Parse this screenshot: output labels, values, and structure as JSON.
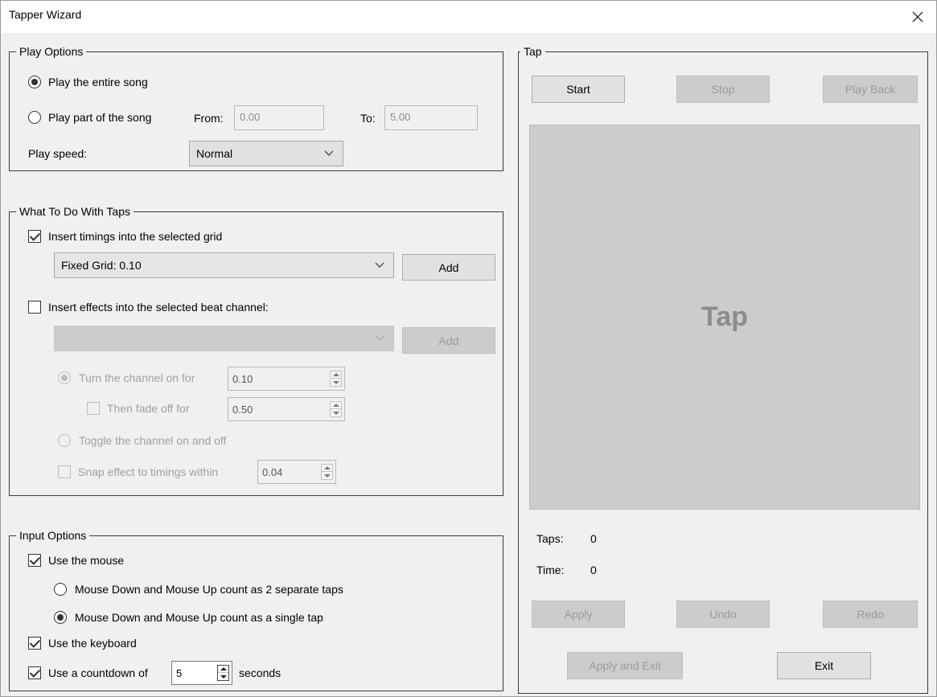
{
  "window": {
    "title": "Tapper Wizard"
  },
  "play_options": {
    "legend": "Play Options",
    "entire_song_label": "Play the entire song",
    "part_song_label": "Play part of the song",
    "from_label": "From:",
    "from_value": "0.00",
    "to_label": "To:",
    "to_value": "5.00",
    "speed_label": "Play speed:",
    "speed_value": "Normal"
  },
  "taps": {
    "legend": "What To Do With Taps",
    "insert_timings_label": "Insert timings into the selected grid",
    "grid_value": "Fixed Grid: 0.10",
    "add_label": "Add",
    "insert_effects_label": "Insert effects into the selected beat channel:",
    "effects_value": "",
    "add2_label": "Add",
    "turn_on_label": "Turn the channel on for",
    "turn_on_value": "0.10",
    "fade_label": "Then fade off for",
    "fade_value": "0.50",
    "toggle_label": "Toggle the channel on and off",
    "snap_label": "Snap effect to timings within",
    "snap_value": "0.04"
  },
  "input_options": {
    "legend": "Input Options",
    "use_mouse_label": "Use the mouse",
    "mouse_separate_label": "Mouse Down and Mouse Up count as 2 separate taps",
    "mouse_single_label": "Mouse Down and Mouse Up count as a single tap",
    "use_keyboard_label": "Use the keyboard",
    "countdown_label": "Use a countdown of",
    "countdown_value": "5",
    "seconds_label": "seconds"
  },
  "tap_panel": {
    "legend": "Tap",
    "start_label": "Start",
    "stop_label": "Stop",
    "playback_label": "Play Back",
    "tap_area_label": "Tap",
    "taps_label": "Taps:",
    "taps_value": "0",
    "time_label": "Time:",
    "time_value": "0",
    "apply_label": "Apply",
    "undo_label": "Undo",
    "redo_label": "Redo",
    "apply_exit_label": "Apply and Exit",
    "exit_label": "Exit"
  }
}
